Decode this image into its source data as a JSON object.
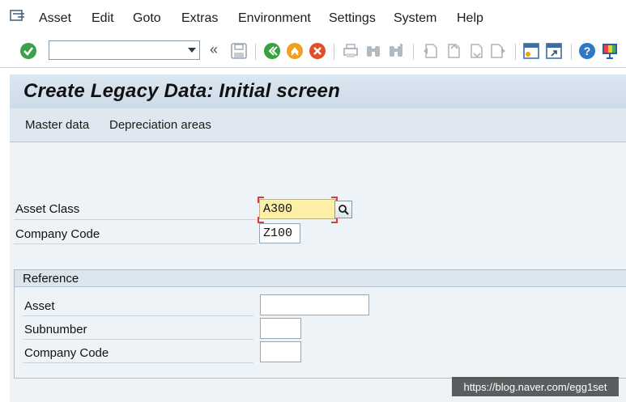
{
  "menubar": {
    "items": [
      "Asset",
      "Edit",
      "Goto",
      "Extras",
      "Environment",
      "Settings",
      "System",
      "Help"
    ]
  },
  "toolbar": {
    "command_field_value": "",
    "icons": [
      "enter-icon",
      "back-icon",
      "save-icon",
      "green-back-icon",
      "exit-icon",
      "cancel-icon",
      "print-icon",
      "find-icon",
      "find-next-icon",
      "first-page-icon",
      "prev-page-icon",
      "next-page-icon",
      "last-page-icon",
      "create-session-icon",
      "shortcut-icon",
      "help-icon",
      "customize-layout-icon"
    ]
  },
  "title": "Create Legacy Data: Initial screen",
  "app_toolbar": {
    "master_data": "Master data",
    "depreciation_areas": "Depreciation areas"
  },
  "form": {
    "asset_class": {
      "label": "Asset Class",
      "value": "A300"
    },
    "company_code": {
      "label": "Company Code",
      "value": "Z100"
    }
  },
  "reference": {
    "title": "Reference",
    "asset": {
      "label": "Asset",
      "value": ""
    },
    "subnumber": {
      "label": "Subnumber",
      "value": ""
    },
    "company_code": {
      "label": "Company Code",
      "value": ""
    }
  },
  "watermark": "https://blog.naver.com/egg1set"
}
